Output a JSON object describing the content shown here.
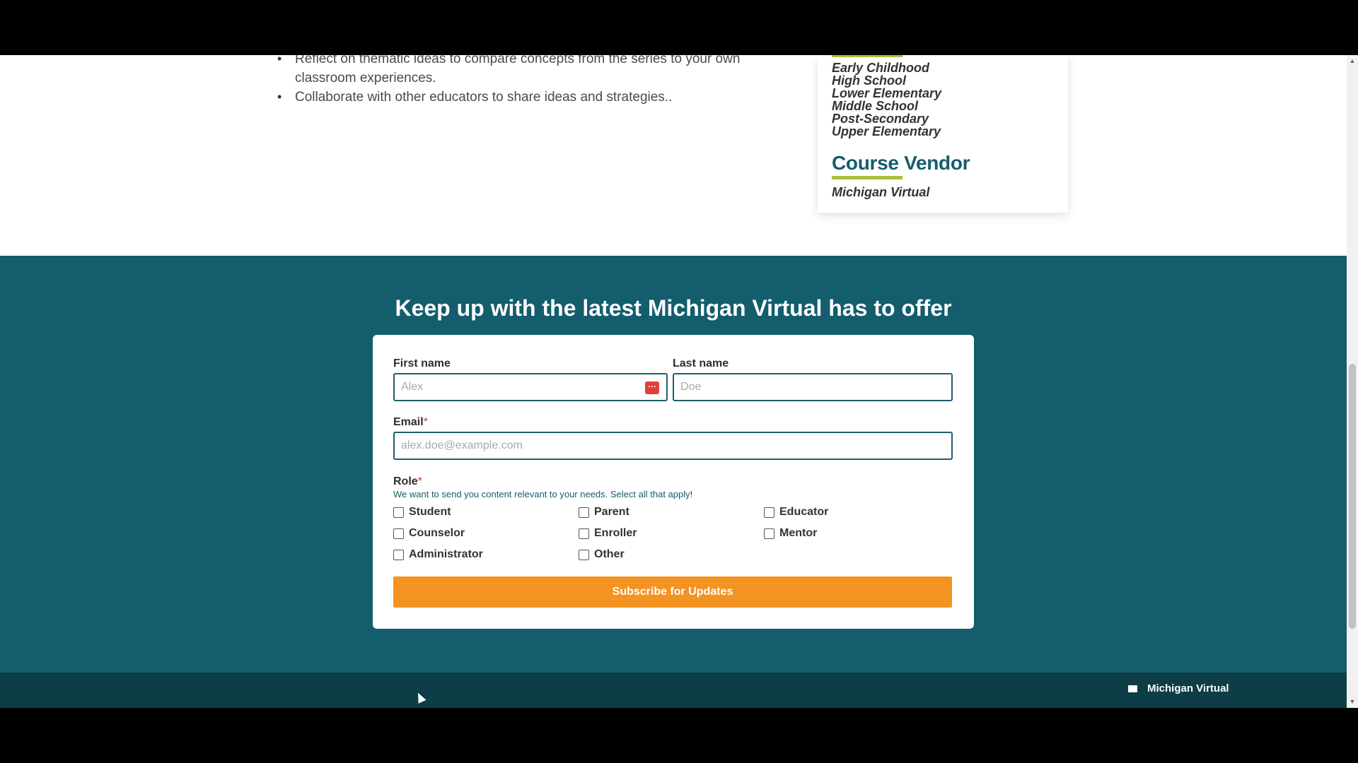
{
  "article": {
    "bullets": [
      "Reflect on thematic ideas to compare concepts from the series to your own classroom experiences.",
      "Collaborate with other educators to share ideas and strategies.."
    ]
  },
  "sidecard": {
    "grades": [
      "Early Childhood",
      "High School",
      "Lower Elementary",
      "Middle School",
      "Post-Secondary",
      "Upper Elementary"
    ],
    "vendor_heading": "Course Vendor",
    "vendor_name": "Michigan Virtual"
  },
  "newsletter": {
    "title": "Keep up with the latest Michigan Virtual has to offer",
    "first_name_label": "First name",
    "first_name_placeholder": "Alex",
    "last_name_label": "Last name",
    "last_name_placeholder": "Doe",
    "email_label": "Email",
    "email_placeholder": "alex.doe@example.com",
    "required_mark": "*",
    "role_label": "Role",
    "role_help": "We want to send you content relevant to your needs. Select all that apply!",
    "roles": [
      "Student",
      "Parent",
      "Educator",
      "Counselor",
      "Enroller",
      "Mentor",
      "Administrator",
      "Other"
    ],
    "submit_label": "Subscribe for Updates"
  },
  "footer": {
    "brand": "Michigan Virtual"
  },
  "colors": {
    "band": "#135d6d",
    "accent_green": "#a6c33a",
    "button": "#f39321",
    "footer": "#0d3d47"
  }
}
